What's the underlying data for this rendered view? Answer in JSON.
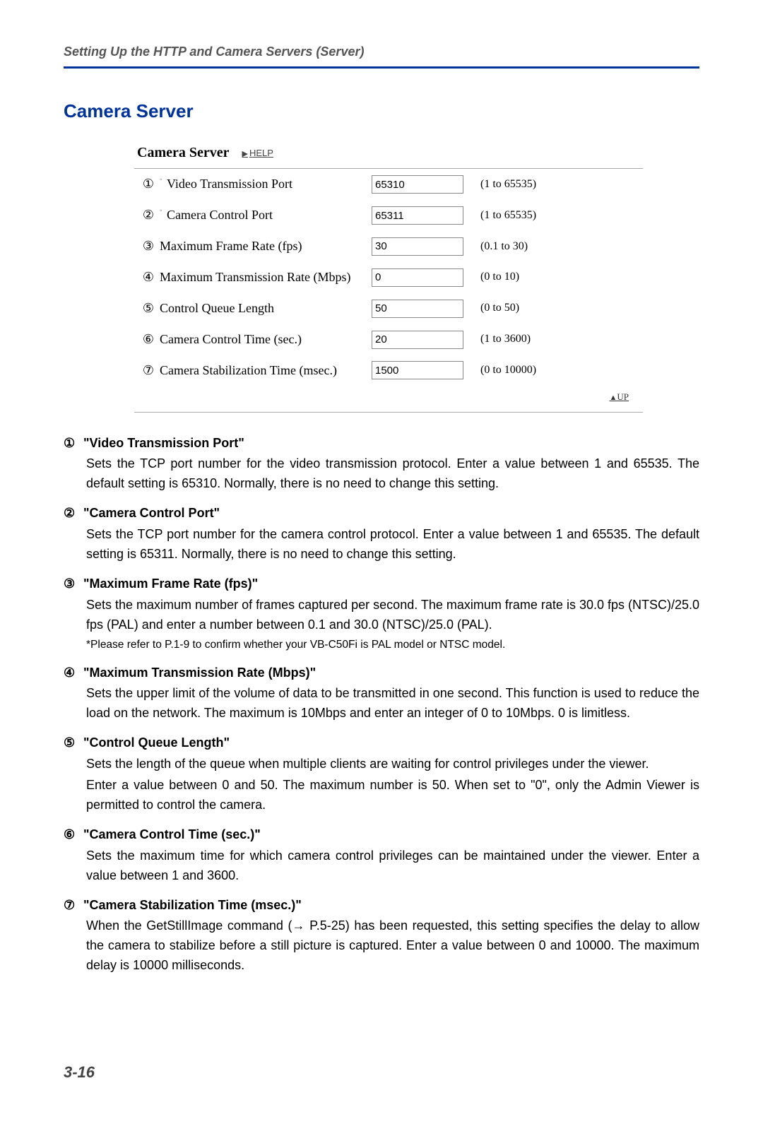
{
  "header": {
    "breadcrumb": "Setting Up the HTTP and Camera Servers (Server)"
  },
  "section": {
    "title": "Camera Server"
  },
  "panel": {
    "title": "Camera Server",
    "help": "HELP",
    "rows": [
      {
        "circ": "①",
        "dot": "◦",
        "label": "Video Transmission Port",
        "value": "65310",
        "range": "(1 to 65535)"
      },
      {
        "circ": "②",
        "dot": "◦",
        "label": "Camera Control Port",
        "value": "65311",
        "range": "(1 to 65535)"
      },
      {
        "circ": "③",
        "dot": "",
        "label": "Maximum Frame Rate (fps)",
        "value": "30",
        "range": "(0.1 to 30)"
      },
      {
        "circ": "④",
        "dot": "",
        "label": "Maximum Transmission Rate (Mbps)",
        "value": "0",
        "range": "(0 to 10)"
      },
      {
        "circ": "⑤",
        "dot": "",
        "label": "Control Queue Length",
        "value": "50",
        "range": "(0 to 50)"
      },
      {
        "circ": "⑥",
        "dot": "",
        "label": "Camera Control Time (sec.)",
        "value": "20",
        "range": "(1 to 3600)"
      },
      {
        "circ": "⑦",
        "dot": "",
        "label": "Camera Stabilization Time (msec.)",
        "value": "1500",
        "range": "(0 to 10000)"
      }
    ],
    "up": "UP"
  },
  "descriptions": [
    {
      "circ": "①",
      "title": "\"Video Transmission Port\"",
      "body": "Sets the TCP port number for the video transmission protocol. Enter a value between 1 and 65535. The default setting is 65310. Normally, there is no need to change this setting.",
      "note": ""
    },
    {
      "circ": "②",
      "title": "\"Camera Control Port\"",
      "body": "Sets the TCP port number for the camera control protocol. Enter a value between 1 and 65535. The default setting is 65311. Normally, there is no need to change this setting.",
      "note": ""
    },
    {
      "circ": "③",
      "title": "\"Maximum Frame Rate (fps)\"",
      "body": "Sets the maximum number of frames captured per second. The maximum frame rate is 30.0 fps (NTSC)/25.0 fps (PAL) and enter a number between 0.1 and 30.0 (NTSC)/25.0 (PAL).",
      "note": "*Please refer to P.1-9 to confirm whether your VB-C50Fi is PAL model or NTSC model."
    },
    {
      "circ": "④",
      "title": "\"Maximum Transmission Rate (Mbps)\"",
      "body": "Sets the upper limit of the volume of data to be transmitted in one second. This function is used to reduce the load on the network. The maximum is 10Mbps and enter an integer of 0 to 10Mbps. 0 is limitless.",
      "note": ""
    },
    {
      "circ": "⑤",
      "title": "\"Control Queue Length\"",
      "body": "Sets the length of the queue when multiple clients are waiting for control privileges under the viewer.",
      "body2": "Enter a value between 0 and 50. The maximum number is 50. When set to \"0\", only the Admin Viewer is permitted to control the camera.",
      "note": ""
    },
    {
      "circ": "⑥",
      "title": "\"Camera Control Time (sec.)\"",
      "body": "Sets the maximum time for which camera control privileges can be maintained under the viewer. Enter a value between 1 and 3600.",
      "note": ""
    },
    {
      "circ": "⑦",
      "title": "\"Camera Stabilization Time (msec.)\"",
      "body": "When the GetStillImage command (→ P.5-25) has been requested, this setting specifies the delay to allow the camera to stabilize before a still picture is captured. Enter a value between 0 and 10000. The maximum delay is 10000 milliseconds.",
      "note": ""
    }
  ],
  "footer": {
    "page": "3-16"
  }
}
